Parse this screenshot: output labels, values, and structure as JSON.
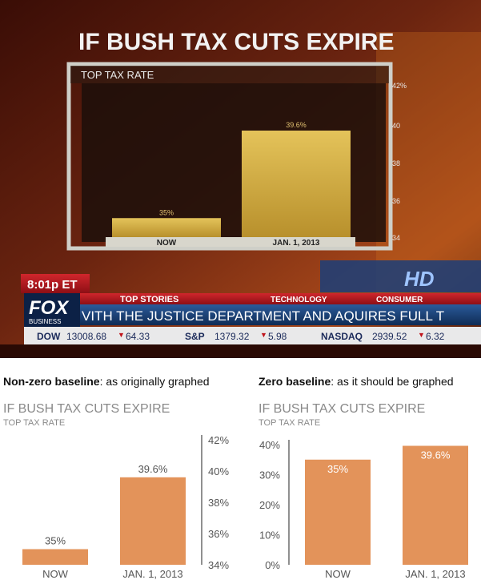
{
  "broadcast": {
    "headline": "IF BUSH TAX CUTS EXPIRE",
    "subtitle": "TOP TAX RATE",
    "categories": [
      "NOW",
      "JAN. 1, 2013"
    ],
    "value_labels": [
      "35%",
      "39.6%"
    ],
    "values": [
      35,
      39.6
    ],
    "y_ticks": [
      "42%",
      "40",
      "38",
      "36",
      "34"
    ],
    "ylim": [
      34,
      42
    ],
    "time": "8:01p ET",
    "logo": "FOX",
    "logo_sub": "BUSINESS",
    "tabs": [
      "TOP STORIES",
      "TECHNOLOGY",
      "CONSUMER"
    ],
    "ticker_text": "VITH THE JUSTICE DEPARTMENT AND AQUIRES FULL T",
    "hd_badge": "HD",
    "markets": [
      {
        "name": "DOW",
        "value": "13008.68",
        "change": "64.33"
      },
      {
        "name": "S&P",
        "value": "1379.32",
        "change": "5.98"
      },
      {
        "name": "NASDAQ",
        "value": "2939.52",
        "change": "6.32"
      }
    ],
    "colors": {
      "bar": "#c9a43e",
      "accent_red": "#b5141c",
      "background": "#6f2b12"
    }
  },
  "left_panel": {
    "heading_bold": "Non-zero baseline",
    "heading_rest": ": as originally graphed"
  },
  "right_panel": {
    "heading_bold": "Zero baseline",
    "heading_rest": ": as it should be graphed"
  },
  "chart_data": [
    {
      "type": "bar",
      "title": "IF BUSH TAX CUTS EXPIRE",
      "subtitle": "TOP TAX RATE",
      "categories": [
        "NOW",
        "JAN. 1, 2013"
      ],
      "values": [
        35,
        39.6
      ],
      "value_labels": [
        "35%",
        "39.6%"
      ],
      "ylim": [
        34,
        42
      ],
      "y_ticks": [
        34,
        36,
        38,
        40,
        42
      ],
      "y_tick_labels": [
        "34%",
        "36%",
        "38%",
        "40%",
        "42%"
      ],
      "axis_side": "right",
      "color": "#e3935a"
    },
    {
      "type": "bar",
      "title": "IF BUSH TAX CUTS EXPIRE",
      "subtitle": "TOP TAX RATE",
      "categories": [
        "NOW",
        "JAN. 1, 2013"
      ],
      "values": [
        35,
        39.6
      ],
      "value_labels": [
        "35%",
        "39.6%"
      ],
      "ylim": [
        0,
        40
      ],
      "y_ticks": [
        0,
        10,
        20,
        30,
        40
      ],
      "y_tick_labels": [
        "0%",
        "10%",
        "20%",
        "30%",
        "40%"
      ],
      "axis_side": "left",
      "color": "#e3935a"
    }
  ]
}
